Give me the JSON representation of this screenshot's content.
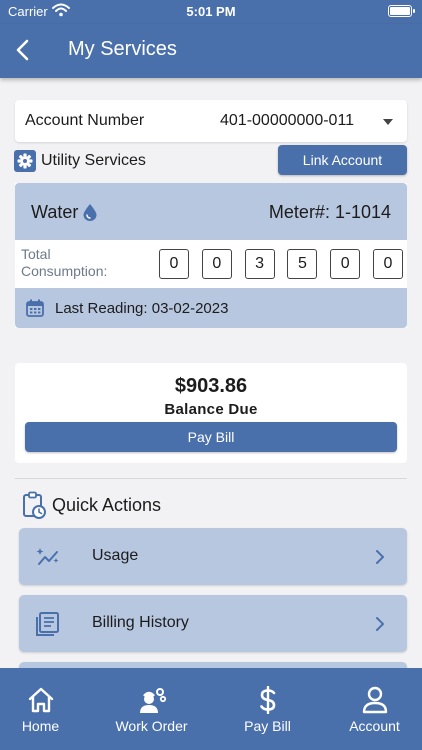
{
  "status_bar": {
    "carrier": "Carrier",
    "time": "5:01 PM"
  },
  "navbar": {
    "title": "My Services"
  },
  "account": {
    "label": "Account Number",
    "value": "401-00000000-011"
  },
  "utility": {
    "label": "Utility Services",
    "link_button": "Link Account"
  },
  "service": {
    "name": "Water",
    "meter": "Meter#: 1-1014",
    "consumption_label": "Total Consumption:",
    "digits": [
      "0",
      "0",
      "3",
      "5",
      "0",
      "0"
    ],
    "last_reading": "Last Reading: 03-02-2023"
  },
  "balance": {
    "amount": "$903.86",
    "label": "Balance Due",
    "pay_button": "Pay Bill"
  },
  "quick_actions": {
    "title": "Quick Actions",
    "items": [
      {
        "label": "Usage",
        "icon": "usage-icon"
      },
      {
        "label": "Billing History",
        "icon": "billing-history-icon"
      }
    ]
  },
  "tabs": [
    {
      "label": "Home",
      "icon": "home-icon"
    },
    {
      "label": "Work Order",
      "icon": "work-order-icon"
    },
    {
      "label": "Pay Bill",
      "icon": "dollar-icon"
    },
    {
      "label": "Account",
      "icon": "account-icon"
    }
  ],
  "colors": {
    "primary": "#4a70ac",
    "light_blue": "#b8c7e0",
    "background": "#f2f2f4"
  }
}
